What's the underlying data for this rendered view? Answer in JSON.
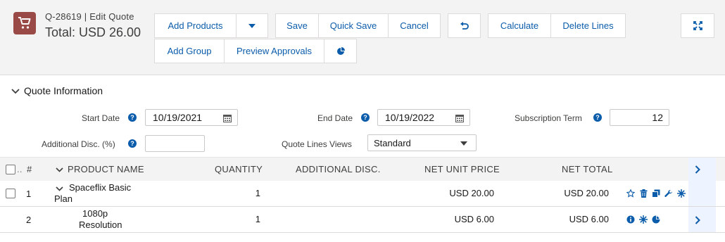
{
  "header": {
    "breadcrumb": "Q-28619 | Edit Quote",
    "total": "Total: USD 26.00",
    "toolbar": {
      "add_products": "Add Products",
      "save": "Save",
      "quick_save": "Quick Save",
      "cancel": "Cancel",
      "calculate": "Calculate",
      "delete_lines": "Delete Lines",
      "add_group": "Add Group",
      "preview_approvals": "Preview Approvals"
    }
  },
  "section": {
    "title": "Quote Information",
    "fields": {
      "start_date_label": "Start Date",
      "start_date_value": "10/19/2021",
      "end_date_label": "End Date",
      "end_date_value": "10/19/2022",
      "subscription_term_label": "Subscription Term",
      "subscription_term_value": "12",
      "additional_disc_label": "Additional Disc. (%)",
      "additional_disc_value": "",
      "quote_lines_views_label": "Quote Lines Views",
      "quote_lines_views_value": "Standard"
    }
  },
  "table": {
    "columns": [
      "#",
      "PRODUCT NAME",
      "QUANTITY",
      "ADDITIONAL DISC.",
      "NET UNIT PRICE",
      "NET TOTAL"
    ],
    "rows": [
      {
        "number": "1",
        "product_line1": "Spaceflix Basic",
        "product_line2": "Plan",
        "quantity": "1",
        "additional_disc": "",
        "net_unit_price": "USD 20.00",
        "net_total": "USD 20.00"
      },
      {
        "number": "2",
        "product_line1": "1080p",
        "product_line2": "Resolution",
        "quantity": "1",
        "additional_disc": "",
        "net_unit_price": "USD 6.00",
        "net_total": "USD 6.00"
      }
    ]
  },
  "colors": {
    "brand_icon": "#9a4a46",
    "link": "#0b5cab",
    "header_bg": "#f3f3f3"
  }
}
